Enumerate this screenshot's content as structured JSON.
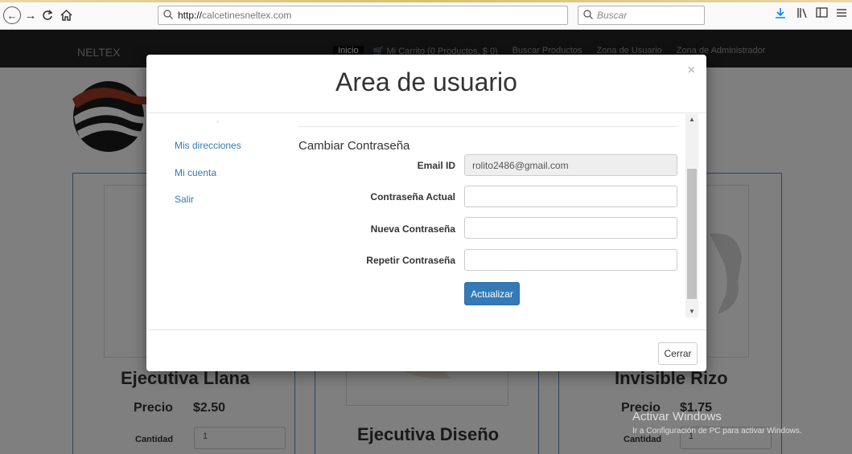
{
  "browser": {
    "url_protocol": "http://",
    "url_host": "calcetinesneltex.com",
    "search_placeholder": "Buscar",
    "nav_back_icon": "←",
    "nav_forward_icon": "→",
    "reload_icon": "C",
    "home_icon": "⌂"
  },
  "navbar": {
    "brand": "NELTEX",
    "links": [
      "Inicio",
      "🛒 Mi Carrito (0 Productos, $ 0)",
      "Buscar Productos",
      "Zona de Usuario",
      "Zona de Administrador"
    ]
  },
  "products": [
    {
      "name": "Ejecutiva Llana",
      "price_label": "Precio",
      "price": "$2.50",
      "qty_label": "Cantidad",
      "qty": "1"
    },
    {
      "name": "Ejecutiva Diseño"
    },
    {
      "name": "Invisible Rizo",
      "price_label": "Precio",
      "price": "$1.75",
      "qty_label": "Cantidad",
      "qty": "1"
    }
  ],
  "watermark": {
    "title": "Activar Windows",
    "subtitle": "Ir a Configuración de PC para activar Windows."
  },
  "modal": {
    "title": "Area de usuario",
    "close_symbol": "×",
    "menu": [
      {
        "label": "Mis direcciones"
      },
      {
        "label": "Mi cuenta"
      },
      {
        "label": "Salir"
      }
    ],
    "section_title": "Cambiar Contraseña",
    "fields": [
      {
        "label": "Email ID",
        "value": "rolito2486@gmail.com",
        "placeholder": "",
        "disabled": true
      },
      {
        "label": "Contraseña Actual",
        "value": "",
        "placeholder": ""
      },
      {
        "label": "Nueva Contraseña",
        "value": "",
        "placeholder": ""
      },
      {
        "label": "Repetir Contraseña",
        "value": "",
        "placeholder": ""
      }
    ],
    "update_button": "Actualizar",
    "close_button": "Cerrar"
  },
  "colors": {
    "link": "#337ab7",
    "primary_button": "#337ab7",
    "navbar_bg": "#222222",
    "card_border": "#5b8cc5"
  }
}
